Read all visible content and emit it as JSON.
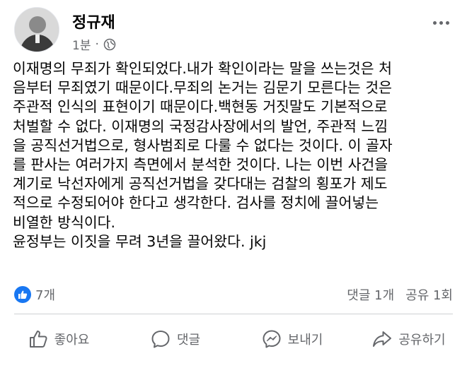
{
  "post": {
    "author": "정규재",
    "time": "1분",
    "separator": "·",
    "privacy_icon": "globe-icon",
    "body_lines": [
      "이재명의 무죄가 확인되었다.내가 확인이라는 말을 쓰는것은 처",
      "음부터 무죄였기 때문이다.무죄의 논거는 김문기 모른다는 것은",
      "주관적 인식의 표현이기 때문이다.백현동 거짓말도 기본적으로",
      "처벌할 수 없다. 이재명의 국정감사장에서의 발언, 주관적 느낌",
      "을 공직선거법으로, 형사범죄로 다룰 수 없다는 것이다. 이 골자",
      "를 판사는 여러가지 측면에서 분석한 것이다. 나는 이번 사건을",
      "계기로 낙선자에게 공직선거법을 갖다대는 검찰의 횡포가 제도",
      "적으로 수정되어야 한다고 생각한다. 검사를 정치에 끌어넣는",
      "비열한 방식이다.",
      "윤정부는 이짓을 무려 3년을 끌어왔다. jkj"
    ]
  },
  "stats": {
    "likes": "7개",
    "comments": "댓글 1개",
    "shares": "공유 1회"
  },
  "actions": {
    "like": "좋아요",
    "comment": "댓글",
    "send": "보내기",
    "share": "공유하기"
  },
  "colors": {
    "accent": "#1877f2",
    "secondary_text": "#65676b",
    "divider": "#ced0d4"
  }
}
